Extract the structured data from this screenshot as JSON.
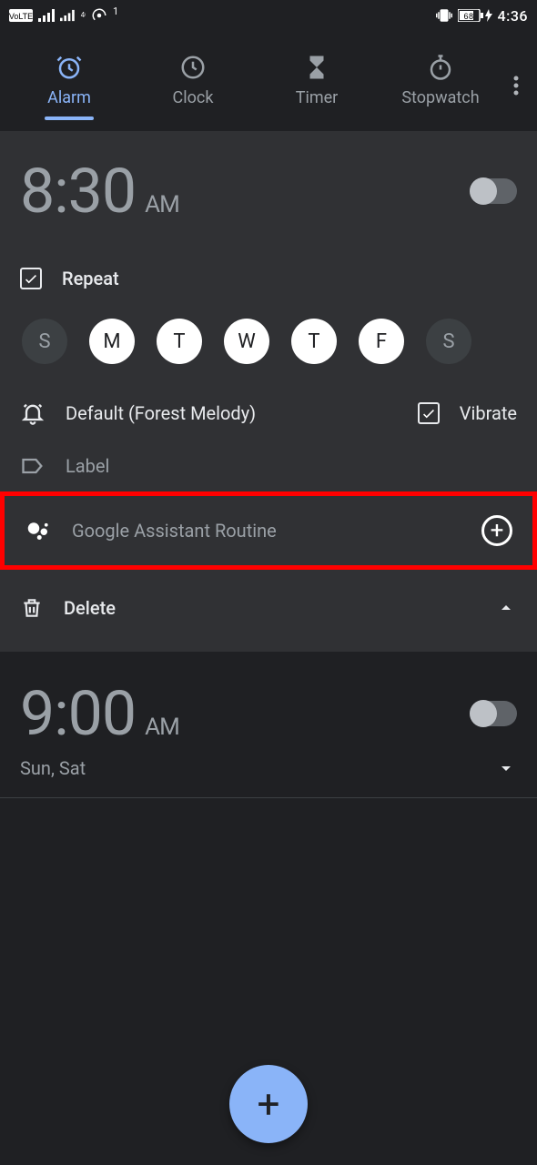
{
  "status": {
    "battery": "68",
    "time": "4:36"
  },
  "tabs": {
    "alarm": "Alarm",
    "clock": "Clock",
    "timer": "Timer",
    "stopwatch": "Stopwatch"
  },
  "alarm1": {
    "time": "8:30",
    "ampm": "AM",
    "repeat_label": "Repeat",
    "days": [
      "S",
      "M",
      "T",
      "W",
      "T",
      "F",
      "S"
    ],
    "days_on": [
      false,
      true,
      true,
      true,
      true,
      true,
      false
    ],
    "ringtone": "Default (Forest Melody)",
    "vibrate_label": "Vibrate",
    "label_label": "Label",
    "routine_label": "Google Assistant Routine",
    "delete_label": "Delete"
  },
  "alarm2": {
    "time": "9:00",
    "ampm": "AM",
    "days_summary": "Sun, Sat"
  }
}
